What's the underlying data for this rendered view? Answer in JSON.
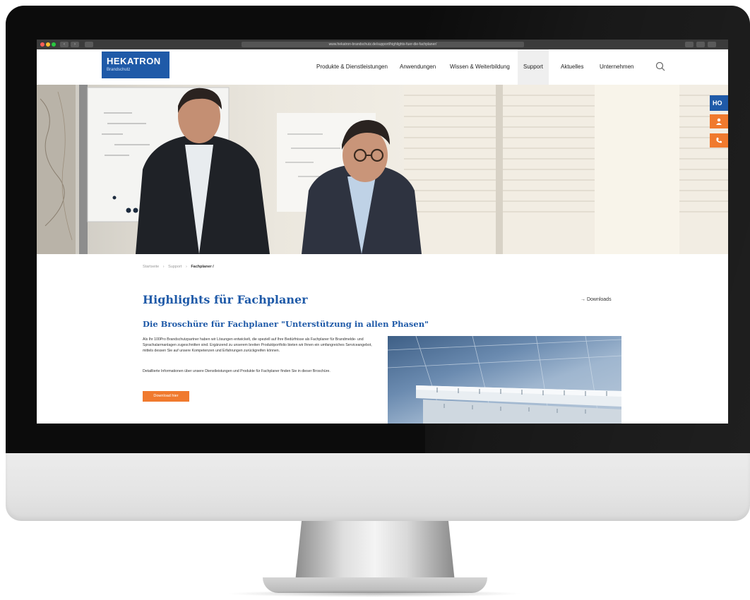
{
  "browser": {
    "url": "www.hekatron-brandschutz.de/support/highlights-fuer-die-fachplaner/",
    "back": "‹",
    "forward": "›"
  },
  "header": {
    "logo_name": "HEKATRON",
    "logo_sub": "Brandschutz",
    "nav": [
      {
        "label": "Produkte & Dienstleistungen"
      },
      {
        "label": "Anwendungen"
      },
      {
        "label": "Wissen & Weiterbildung"
      },
      {
        "label": "Support"
      },
      {
        "label": "Aktuelles"
      },
      {
        "label": "Unternehmen"
      }
    ],
    "active_nav": "Support"
  },
  "side_buttons": {
    "logo_label": "HO",
    "contact_icon": "person-icon",
    "phone_icon": "phone-icon"
  },
  "breadcrumb": {
    "items": [
      "Startseite",
      "Support",
      "Fachplaner /"
    ],
    "separator": "›"
  },
  "main": {
    "title": "Highlights für Fachplaner",
    "downloads_link": "→ Downloads",
    "subtitle": "Die Broschüre für Fachplaner \"Unterstützung in allen Phasen\"",
    "paragraph_1": "Als Ihr 100Pro Brandschutzpartner haben wir Lösungen entwickelt, die speziell auf Ihre Bedürfnisse als Fachplaner für Brandmelde- und Sprachalarmanlagen zugeschnitten sind. Ergänzend zu unserem breiten Produktportfolio bieten wir Ihnen ein umfangreiches Serviceangebot, mittels dessen Sie auf unsere Kompetenzen und Erfahrungen zurückgreifen können.",
    "paragraph_2": "Detaillierte Informationen über unsere Dienstleistungen und Produkte für Fachplaner finden Sie in dieser Broschüre.",
    "cta_label": "Download hier"
  },
  "colors": {
    "brand_blue": "#1f5aa8",
    "accent_orange": "#f07a2e"
  }
}
